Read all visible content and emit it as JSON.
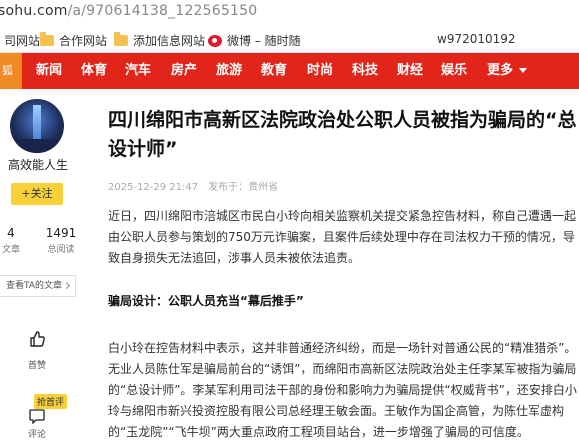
{
  "browser": {
    "url_host": "sohu.com",
    "url_path": "/a/970614138_122565150"
  },
  "bookmarks": {
    "items": [
      {
        "label": "司网站",
        "icon": "blue-icon-partial"
      },
      {
        "label": "合作网站",
        "icon": "folder-icon"
      },
      {
        "label": "添加信息网站",
        "icon": "folder-icon"
      },
      {
        "label": "微博 – 随时随",
        "icon": "weibo-icon"
      }
    ],
    "user_id": "w972010192"
  },
  "nav": {
    "logo_text": "狐",
    "items": [
      "新闻",
      "体育",
      "汽车",
      "房产",
      "旅游",
      "教育",
      "时尚",
      "科技",
      "财经",
      "娱乐"
    ],
    "more_label": "更多",
    "colors": {
      "bar": "#e1251b",
      "logo": "#f08a24"
    }
  },
  "author": {
    "name": "高效能人生",
    "follow_label": "+关注",
    "stats": [
      {
        "value": "4",
        "label": "文章"
      },
      {
        "value": "1491",
        "label": "总阅读"
      }
    ],
    "ta_link": "查看TA的文章"
  },
  "actions": {
    "like_label": "首赞",
    "grab_badge": "抢首评",
    "comment_label": "评论"
  },
  "article": {
    "title": "四川绵阳市高新区法院政治处公职人员被指为骗局的“总设计师”",
    "date": "2025-12-29 21:47",
    "source_label": "发布于：",
    "source": "贵州省",
    "para1": "近日，四川绵阳市涪城区市民白小玲向相关监察机关提交紧急控告材料，称自己遭遇一起由公职人员参与策划的750万元诈骗案，且案件后续处理中存在司法权力干预的情况，导致自身损失无法追回，涉事人员未被依法追责。",
    "subhead": "骗局设计：公职人员充当“幕后推手”",
    "para2": "白小玲在控告材料中表示，这并非普通经济纠纷，而是一场针对普通公民的“精准猎杀”。无业人员陈仕军是骗局前台的“诱饵”，而绵阳市高新区法院政治处主任李某军被指为骗局的“总设计师”。李某军利用司法干部的身份和影响力为骗局提供“权威背书”，还安排白小玲与绵阳市新兴投资控股有限公司总经理王敏会面。王敏作为国企高管，为陈仕军虚构的“玉龙院”“飞牛坝”两大重点政府工程项目站台，进一步增强了骗局的可信度。"
  }
}
